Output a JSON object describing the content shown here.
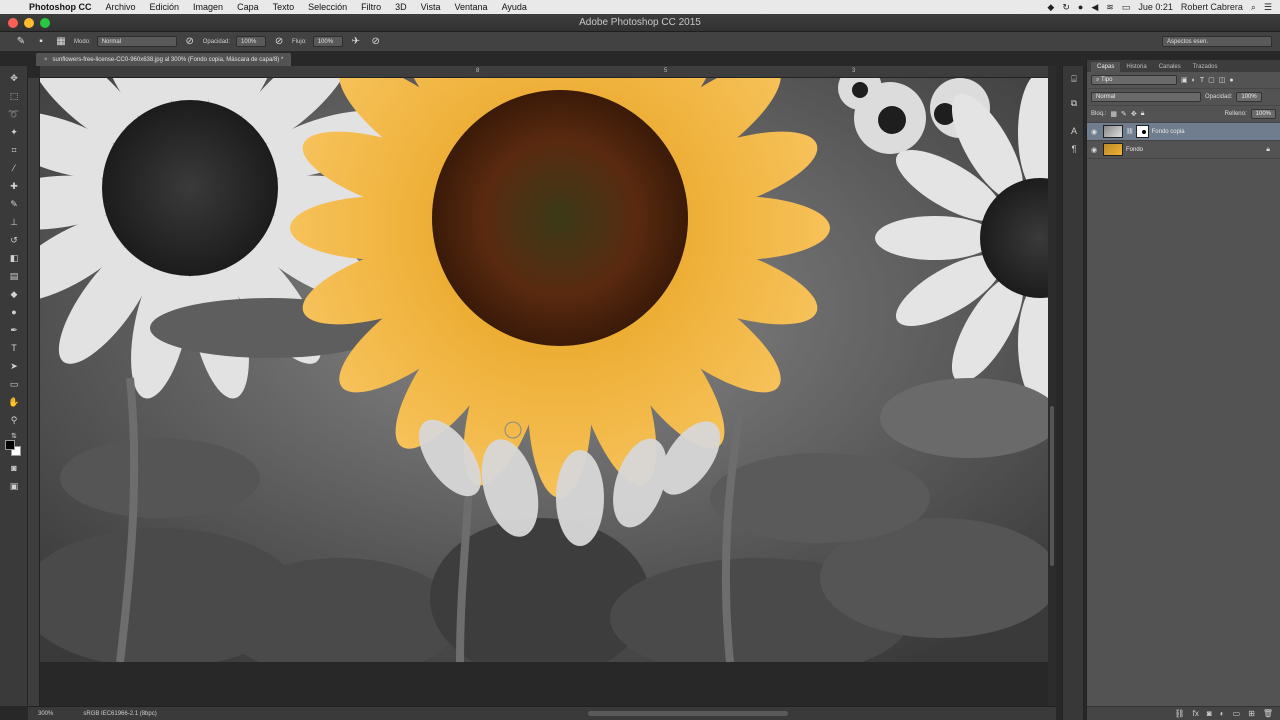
{
  "menubar": {
    "app": "Photoshop CC",
    "items": [
      "Archivo",
      "Edición",
      "Imagen",
      "Capa",
      "Texto",
      "Selección",
      "Filtro",
      "3D",
      "Vista",
      "Ventana",
      "Ayuda"
    ],
    "clock": "Jue 0:21",
    "user": "Robert Cabrera"
  },
  "window": {
    "title": "Adobe Photoshop CC 2015"
  },
  "options": {
    "mode_label": "Modo:",
    "mode_value": "Normal",
    "opacity_label": "Opacidad:",
    "opacity_value": "100%",
    "flow_label": "Flujo:",
    "flow_value": "100%",
    "workspace": "Aspectos esen."
  },
  "document": {
    "tab_title": "sunflowers-free-license-CC0-960x638.jpg al 300% (Fondo copia, Máscara de capa/8) *"
  },
  "ruler": {
    "marks": [
      "8",
      "5",
      "3"
    ]
  },
  "status": {
    "zoom": "300%",
    "profile": "sRGB IEC61966-2.1 (8bpc)"
  },
  "layers_panel": {
    "tabs": [
      "Capas",
      "Historia",
      "Canales",
      "Trazados"
    ],
    "filter_label": "Tipo",
    "blend_mode": "Normal",
    "opacity_label": "Opacidad:",
    "opacity_value": "100%",
    "lock_label": "Bloq.:",
    "fill_label": "Relleno:",
    "fill_value": "100%",
    "layers": [
      {
        "name": "Fondo copia",
        "active": true,
        "has_mask": true
      },
      {
        "name": "Fondo",
        "active": false,
        "locked": true
      }
    ]
  },
  "colors": {
    "accent": "#6f7d8f",
    "sunflower": "#f2b233"
  }
}
